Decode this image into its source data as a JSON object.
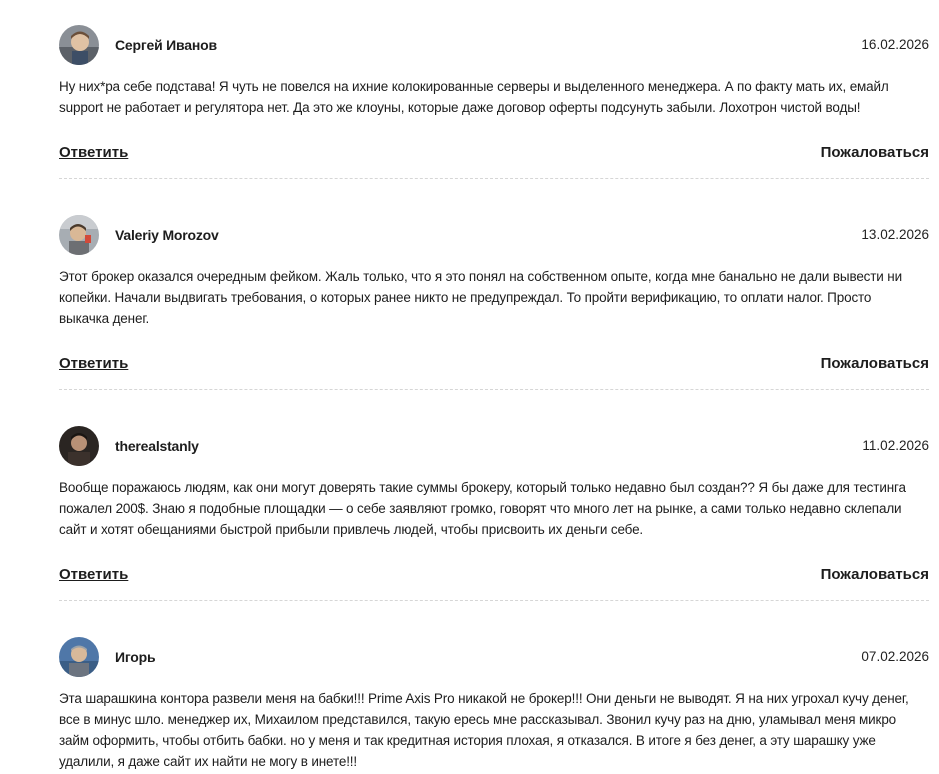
{
  "actions": {
    "reply_label": "Ответить",
    "complain_label": "Пожаловаться"
  },
  "reviews": [
    {
      "author": "Сергей Иванов",
      "date": "16.02.2026",
      "text": "Ну них*ра себе подстава! Я чуть не повелся на ихние колокированные серверы и выделенного менеджера. А по факту мать их, емайл support не работает и регулятора нет. Да это же клоуны, которые даже договор оферты подсунуть забыли. Лохотрон чистой воды!"
    },
    {
      "author": "Valeriy Morozov",
      "date": "13.02.2026",
      "text": "Этот брокер оказался очередным фейком. Жаль только, что я это понял на собственном опыте, когда мне банально не дали вывести ни копейки. Начали выдвигать требования, о которых ранее никто не предупреждал. То пройти верификацию, то оплати налог. Просто выкачка денег."
    },
    {
      "author": "therealstanly",
      "date": "11.02.2026",
      "text": "Вообще поражаюсь людям, как они могут доверять такие суммы брокеру, который только недавно был создан?? Я бы даже для тестинга пожалел 200$. Знаю я подобные площадки — о себе заявляют громко, говорят что много лет на рынке, а сами только недавно склепали сайт и хотят обещаниями быстрой прибыли привлечь людей, чтобы присвоить их деньги себе."
    },
    {
      "author": "Игорь",
      "date": "07.02.2026",
      "text": "Эта шарашкина контора развели меня на бабки!!! Prime Axis Pro никакой не брокер!!! Они деньги не выводят. Я на них угрохал кучу денег, все в минус шло. менеджер их, Михаилом представился, такую ересь мне рассказывал. Звонил кучу раз на дню, уламывал меня микро займ оформить, чтобы отбить бабки. но у меня и так кредитная история плохая, я отказался. В итоге я без денег, а эту шарашку уже удалили, я даже сайт их найти не могу в инете!!!"
    }
  ]
}
